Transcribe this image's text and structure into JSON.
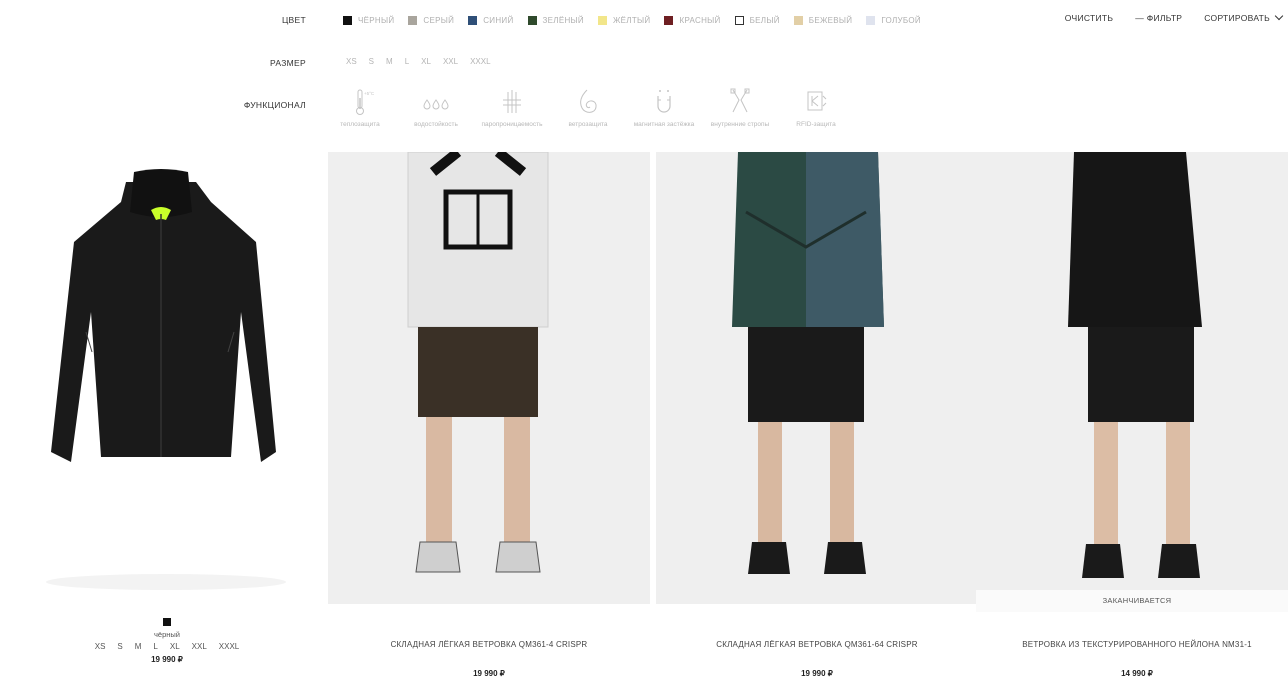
{
  "filters": {
    "color_label": "ЦВЕТ",
    "size_label": "РАЗМЕР",
    "function_label": "ФУНКЦИОНАЛ",
    "colors": [
      {
        "name": "ЧЁРНЫЙ",
        "hex": "#111111"
      },
      {
        "name": "СЕРЫЙ",
        "hex": "#a9a59d"
      },
      {
        "name": "СИНИЙ",
        "hex": "#2f4f78"
      },
      {
        "name": "ЗЕЛЁНЫЙ",
        "hex": "#2f4a2c"
      },
      {
        "name": "ЖЁЛТЫЙ",
        "hex": "#f2e68a"
      },
      {
        "name": "КРАСНЫЙ",
        "hex": "#6e1f22"
      },
      {
        "name": "БЕЛЫЙ",
        "hex": "#ffffff"
      },
      {
        "name": "БЕЖЕВЫЙ",
        "hex": "#e2cfa6"
      },
      {
        "name": "ГОЛУБОЙ",
        "hex": "#dfe3ee"
      }
    ],
    "sizes": [
      "XS",
      "S",
      "M",
      "L",
      "XL",
      "XXL",
      "XXXL"
    ],
    "functions": [
      {
        "icon": "thermometer-icon",
        "label": "теплозащита",
        "badge": "+5°C"
      },
      {
        "icon": "water-drops-icon",
        "label": "водостойкость"
      },
      {
        "icon": "breathable-icon",
        "label": "паропроницаемость"
      },
      {
        "icon": "wind-spiral-icon",
        "label": "ветрозащита"
      },
      {
        "icon": "magnet-icon",
        "label": "магнитная застёжка"
      },
      {
        "icon": "straps-icon",
        "label": "внутренние стропы"
      },
      {
        "icon": "rfid-icon",
        "label": "RFID-защита"
      }
    ]
  },
  "actions": {
    "clear": "ОЧИСТИТЬ",
    "filter": "— ФИЛЬТР",
    "sort": "СОРТИРОВАТЬ"
  },
  "products": [
    {
      "color": "чёрный",
      "sizes": [
        "XS",
        "S",
        "M",
        "L",
        "XL",
        "XXL",
        "XXXL"
      ],
      "price": "19 990 ₽"
    },
    {
      "name": "СКЛАДНАЯ ЛЁГКАЯ ВЕТРОВКА QM361-4 CRISPR",
      "price": "19 990 ₽"
    },
    {
      "name": "СКЛАДНАЯ ЛЁГКАЯ ВЕТРОВКА QM361-64 CRISPR",
      "price": "19 990 ₽"
    },
    {
      "name": "ВЕТРОВКА ИЗ ТЕКСТУРИРОВАННОГО НЕЙЛОНА NM31-1",
      "price": "14 990 ₽",
      "badge": "ЗАКАНЧИВАЕТСЯ"
    }
  ]
}
